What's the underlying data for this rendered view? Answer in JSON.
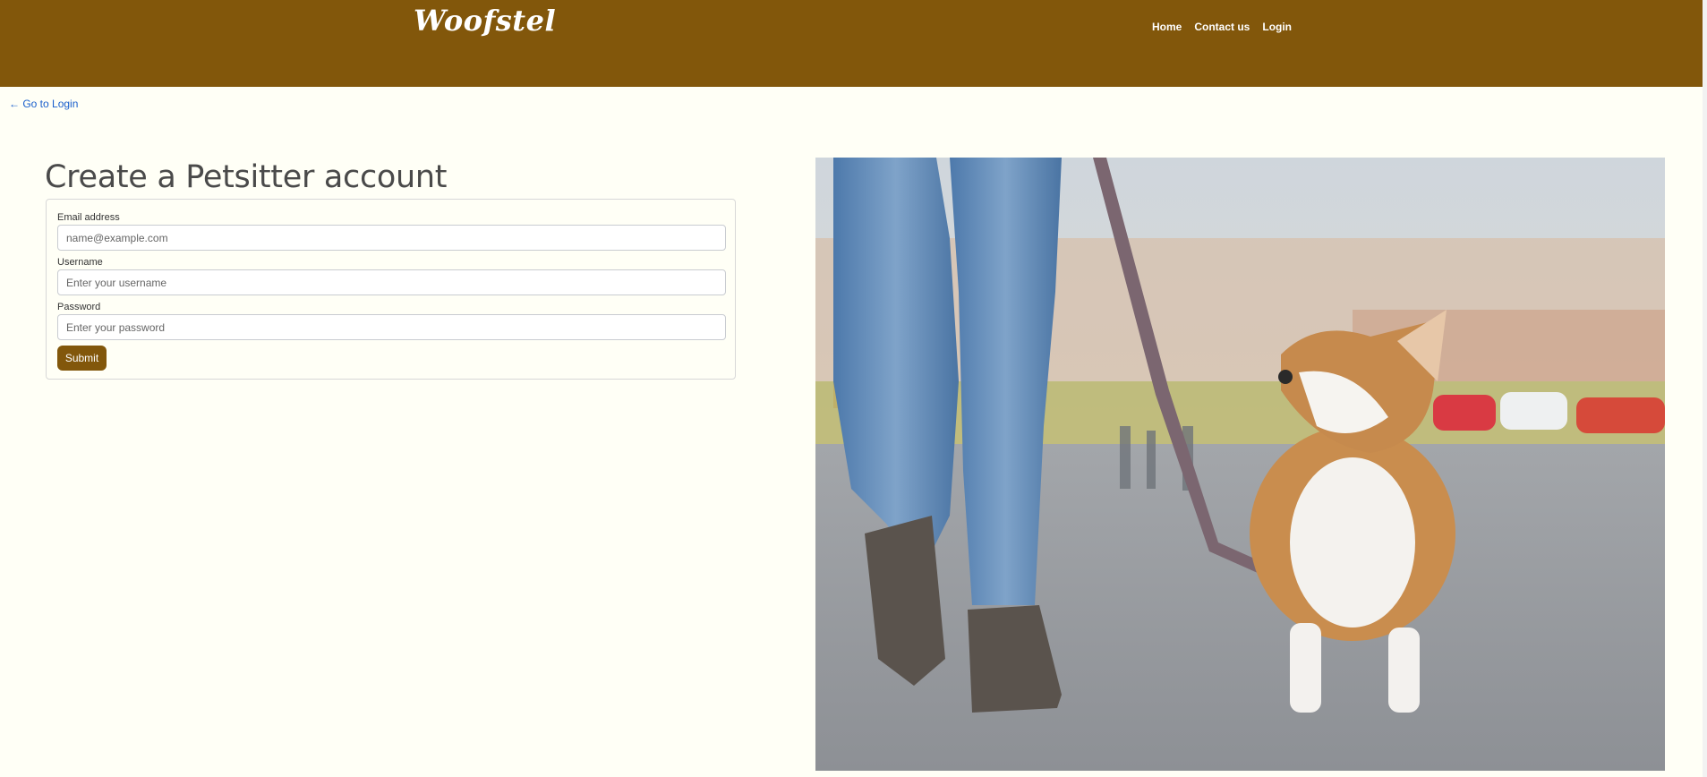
{
  "header": {
    "brand": "Woofstel",
    "nav": [
      {
        "label": "Home"
      },
      {
        "label": "Contact us"
      },
      {
        "label": "Login"
      }
    ]
  },
  "back_link": "← Go to Login",
  "page_title": "Create a Petsitter account",
  "form": {
    "email_label": "Email address",
    "email_placeholder": "name@example.com",
    "email_value": "",
    "username_label": "Username",
    "username_placeholder": "Enter your username",
    "username_value": "",
    "password_label": "Password",
    "password_placeholder": "Enter your password",
    "password_value": "",
    "submit_label": "Submit"
  },
  "colors": {
    "brand": "#82570b",
    "page_background": "#fffff6",
    "link": "#1a5fcc"
  }
}
